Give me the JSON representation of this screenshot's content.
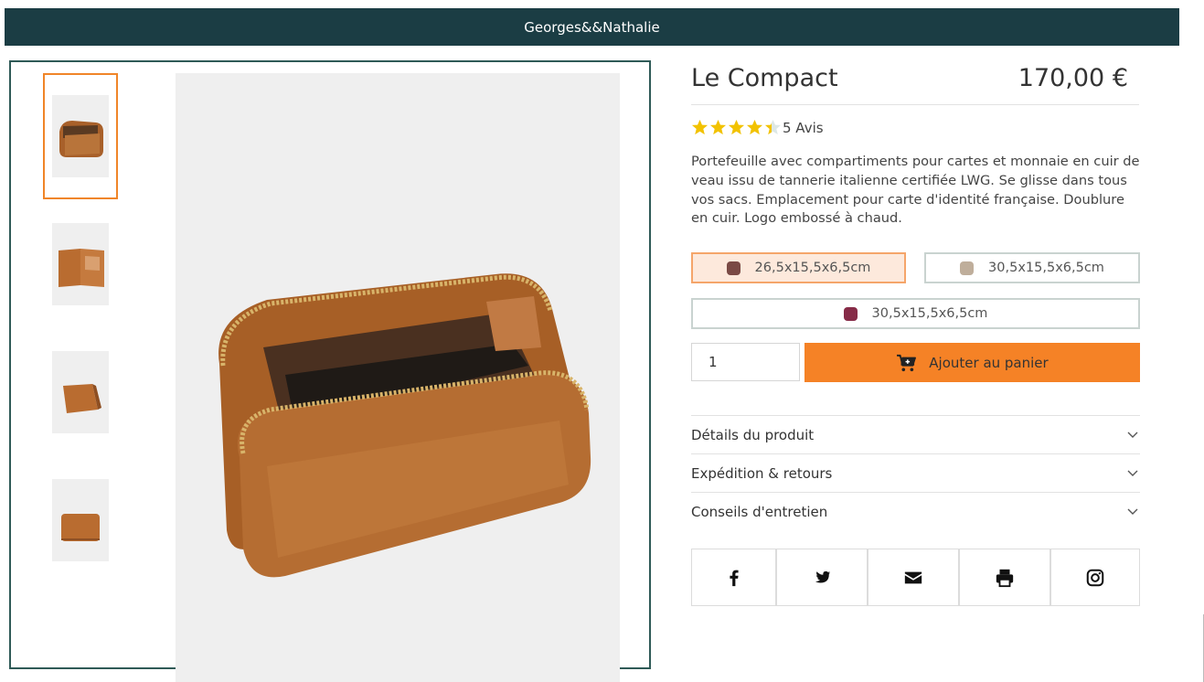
{
  "header": {
    "brand": "Georges&&Nathalie"
  },
  "gallery": {
    "thumbnails": [
      {
        "name": "thumb-1",
        "active": true
      },
      {
        "name": "thumb-2",
        "active": false
      },
      {
        "name": "thumb-3",
        "active": false
      },
      {
        "name": "thumb-4",
        "active": false
      }
    ]
  },
  "product": {
    "title": "Le Compact",
    "price": "170,00 €",
    "rating": {
      "stars": 4,
      "max": 5,
      "reviews_label": "5 Avis"
    },
    "description": "Portefeuille avec compartiments pour cartes et monnaie en cuir de veau issu de tannerie italienne certifiée  LWG. Se glisse dans tous vos sacs. Emplacement pour carte d'identité française.  Doublure en cuir.  Logo embossé à chaud."
  },
  "variants": [
    {
      "label": "26,5x15,5x6,5cm",
      "color": "#7a4a45",
      "selected": true
    },
    {
      "label": "30,5x15,5x6,5cm",
      "color": "#bfae9b",
      "selected": false
    },
    {
      "label": "30,5x15,5x6,5cm",
      "color": "#862b47",
      "selected": false
    }
  ],
  "cart": {
    "quantity": "1",
    "add_label": "Ajouter au panier"
  },
  "accordions": [
    {
      "label": "Détails du produit"
    },
    {
      "label": "Expédition & retours"
    },
    {
      "label": "Conseils d'entretien"
    }
  ],
  "share": [
    {
      "icon": "facebook-icon"
    },
    {
      "icon": "twitter-icon"
    },
    {
      "icon": "envelope-icon"
    },
    {
      "icon": "print-icon"
    },
    {
      "icon": "instagram-icon"
    }
  ],
  "colors": {
    "header": "#1b3d44",
    "accent": "#f58226",
    "frame": "#2f5a57",
    "star": "#f2c200"
  }
}
